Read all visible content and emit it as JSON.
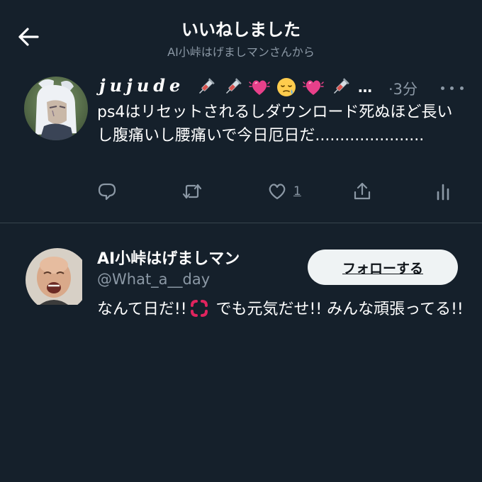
{
  "header": {
    "title": "いいねしました",
    "subtitle": "AI小峠はげましマンさんから"
  },
  "tweet": {
    "author_display_name": "𝒋𝒖𝒋𝒖𝒅𝒆",
    "name_emojis": [
      "syringe-icon",
      "syringe-icon",
      "heart-icon",
      "sleepy-face-icon",
      "heart-icon",
      "syringe-icon"
    ],
    "name_ellipsis": "…",
    "time": "·3分",
    "text": "ps4はリセットされるしダウンロード死ぬほど長いし腹痛いし腰痛いで今日厄日だ......................",
    "like_count": "1"
  },
  "profile": {
    "name": "AI小峠はげましマン",
    "handle": "@What_a__day",
    "follow_label": "フォローする",
    "bio_part1": "なんて日だ!!",
    "bio_emoji": "anger-icon",
    "bio_part2": " でも元気だせ!! みんな頑張ってる!!"
  },
  "colors": {
    "background": "#15202b",
    "text_primary": "#ffffff",
    "text_secondary": "#8b98a5",
    "divider": "#38444d",
    "follow_button_bg": "#eff3f4",
    "heart_emoji": "#e8408a",
    "anger_emoji": "#e0245e"
  }
}
